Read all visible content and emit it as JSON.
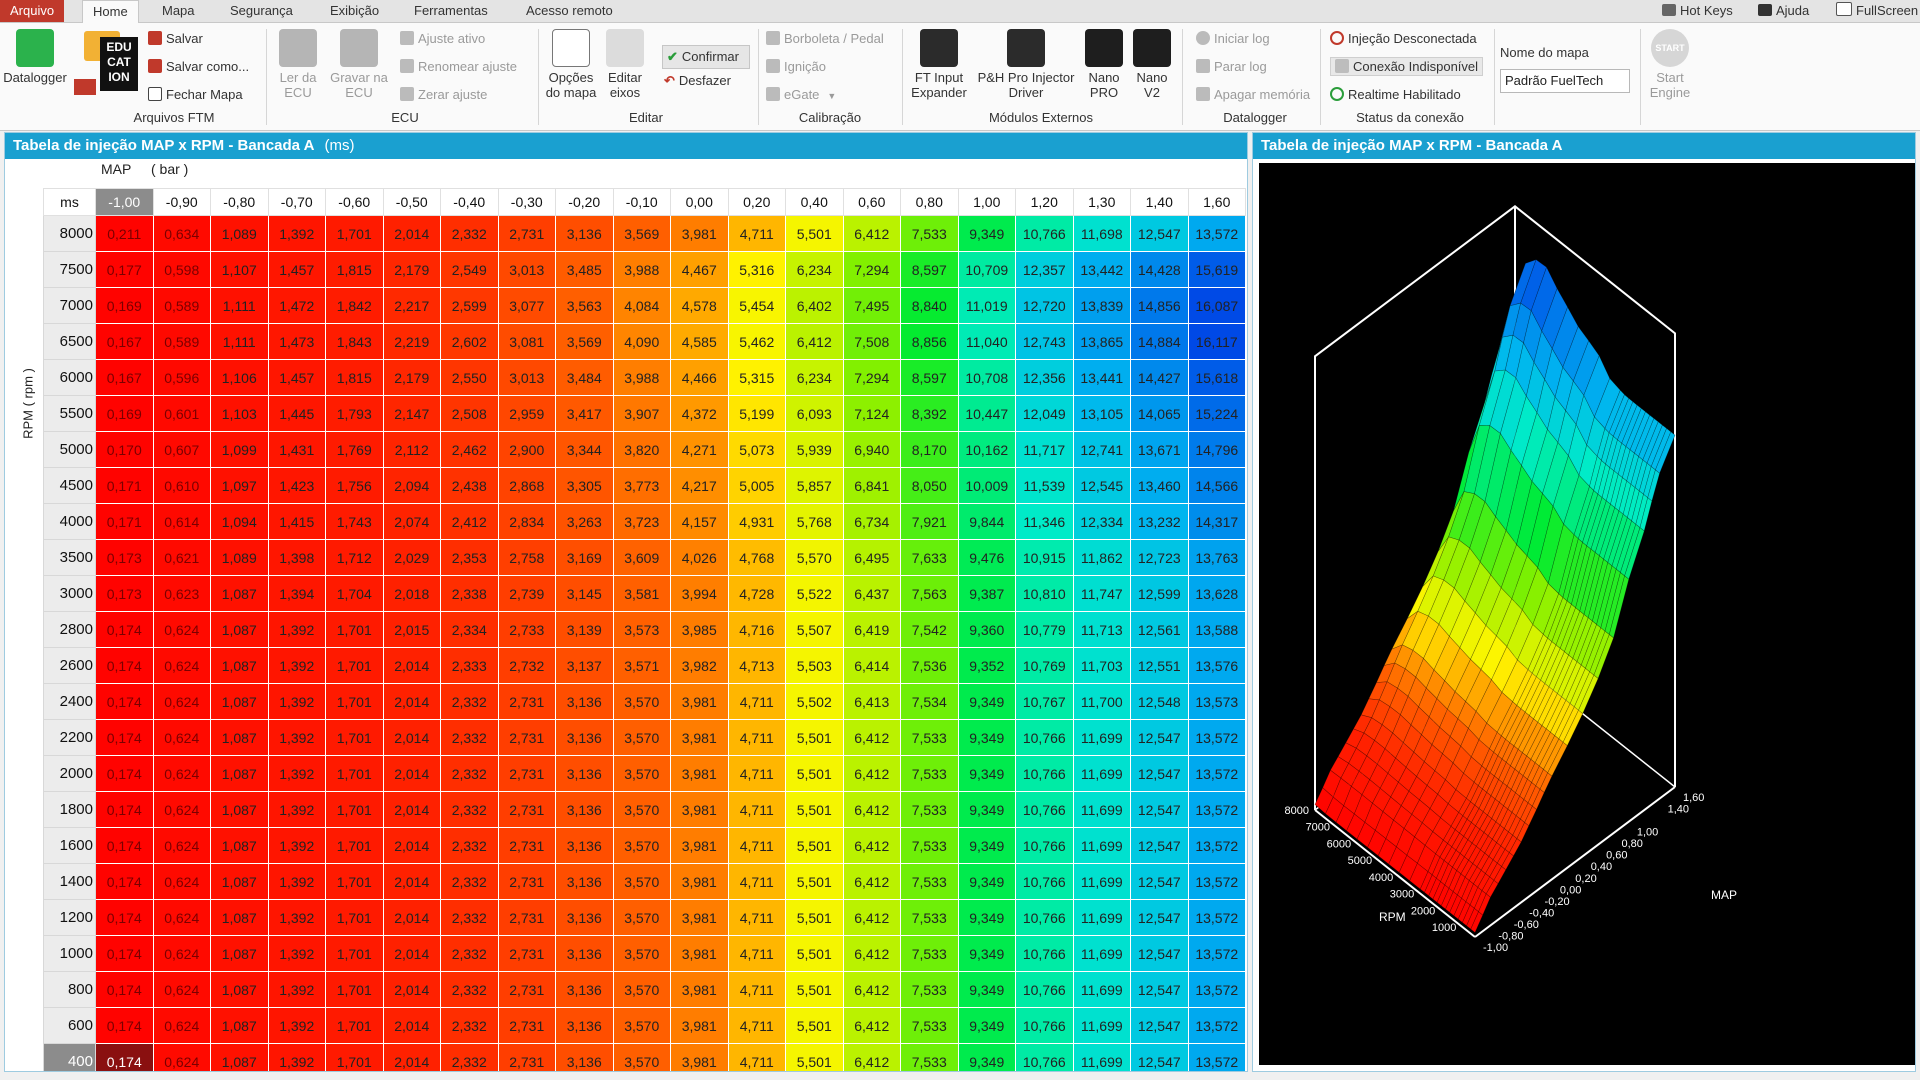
{
  "menubar": {
    "items": [
      "Arquivo",
      "Home",
      "Mapa",
      "Segurança",
      "Exibição",
      "Ferramentas",
      "Acesso remoto"
    ],
    "active": "Home",
    "right": [
      "Hot Keys",
      "Ajuda",
      "FullScreen"
    ]
  },
  "ribbon": {
    "datalogger_app": "Datalogger",
    "arquivos": {
      "salvar": "Salvar",
      "salvar_como": "Salvar como...",
      "fechar": "Fechar Mapa",
      "group": "Arquivos FTM",
      "logo_lines": [
        "EDU",
        "CAT",
        "ION"
      ]
    },
    "ecu": {
      "ler": "Ler da ECU",
      "gravar": "Gravar na ECU",
      "ajuste_ativo": "Ajuste ativo",
      "renomear": "Renomear ajuste",
      "zerar": "Zerar ajuste",
      "group": "ECU"
    },
    "editar": {
      "opcoes": "Opções do mapa",
      "eixos": "Editar eixos",
      "confirmar": "Confirmar",
      "desfazer": "Desfazer",
      "group": "Editar"
    },
    "calibracao": {
      "borboleta": "Borboleta / Pedal",
      "ignicao": "Ignição",
      "egate": "eGate",
      "group": "Calibração"
    },
    "modulos": {
      "ft_input": "FT Input Expander",
      "ph_pro": "P&H Pro Injector Driver",
      "nano_pro": "Nano PRO",
      "nano_v2": "Nano V2",
      "group": "Módulos Externos"
    },
    "datalogger": {
      "iniciar": "Iniciar log",
      "parar": "Parar log",
      "apagar": "Apagar memória",
      "group": "Datalogger"
    },
    "status": {
      "injecao": "Injeção Desconectada",
      "conexao": "Conexão Indisponível",
      "realtime": "Realtime Habilitado",
      "group": "Status da conexão"
    },
    "mapname": {
      "label": "Nome do mapa",
      "value": "Padrão FuelTech"
    },
    "start": {
      "label": "Start Engine",
      "icon_text": "START"
    }
  },
  "table_panel": {
    "title": "Tabela de injeção MAP x RPM - Bancada A",
    "unit": "(ms)",
    "map_label": "MAP",
    "map_unit": "( bar )",
    "corner": "ms",
    "rpm_label": "RPM ( rpm )"
  },
  "plot_panel": {
    "title": "Tabela de injeção MAP x RPM - Bancada A",
    "rpm_axis": "RPM",
    "map_axis": "MAP",
    "rpm_ticks": [
      "8000",
      "7000",
      "6000",
      "5000",
      "4000",
      "3000",
      "2000",
      "1000"
    ],
    "map_ticks": [
      "1,60",
      "1,40",
      "1,00",
      "0,80",
      "0,60",
      "0,40",
      "0,20",
      "0,00",
      "-0,20",
      "-0,40",
      "-0,60",
      "-0,80",
      "-1,00"
    ]
  },
  "colors": {
    "accent": "#1aa0d0",
    "file_menu": "#c0392b"
  },
  "chart_data": {
    "type": "heatmap",
    "title": "Tabela de injeção MAP x RPM - Bancada A",
    "xlabel": "MAP ( bar )",
    "ylabel": "RPM ( rpm )",
    "units": "ms",
    "x": [
      "-1,00",
      "-0,90",
      "-0,80",
      "-0,70",
      "-0,60",
      "-0,50",
      "-0,40",
      "-0,30",
      "-0,20",
      "-0,10",
      "0,00",
      "0,20",
      "0,40",
      "0,60",
      "0,80",
      "1,00",
      "1,20",
      "1,30",
      "1,40",
      "1,60"
    ],
    "y": [
      "8000",
      "7500",
      "7000",
      "6500",
      "6000",
      "5500",
      "5000",
      "4500",
      "4000",
      "3500",
      "3000",
      "2800",
      "2600",
      "2400",
      "2200",
      "2000",
      "1800",
      "1600",
      "1400",
      "1200",
      "1000",
      "800",
      "600",
      "400"
    ],
    "values": [
      [
        "0,211",
        "0,634",
        "1,089",
        "1,392",
        "1,701",
        "2,014",
        "2,332",
        "2,731",
        "3,136",
        "3,569",
        "3,981",
        "4,711",
        "5,501",
        "6,412",
        "7,533",
        "9,349",
        "10,766",
        "11,698",
        "12,547",
        "13,572"
      ],
      [
        "0,177",
        "0,598",
        "1,107",
        "1,457",
        "1,815",
        "2,179",
        "2,549",
        "3,013",
        "3,485",
        "3,988",
        "4,467",
        "5,316",
        "6,234",
        "7,294",
        "8,597",
        "10,709",
        "12,357",
        "13,442",
        "14,428",
        "15,619"
      ],
      [
        "0,169",
        "0,589",
        "1,111",
        "1,472",
        "1,842",
        "2,217",
        "2,599",
        "3,077",
        "3,563",
        "4,084",
        "4,578",
        "5,454",
        "6,402",
        "7,495",
        "8,840",
        "11,019",
        "12,720",
        "13,839",
        "14,856",
        "16,087"
      ],
      [
        "0,167",
        "0,589",
        "1,111",
        "1,473",
        "1,843",
        "2,219",
        "2,602",
        "3,081",
        "3,569",
        "4,090",
        "4,585",
        "5,462",
        "6,412",
        "7,508",
        "8,856",
        "11,040",
        "12,743",
        "13,865",
        "14,884",
        "16,117"
      ],
      [
        "0,167",
        "0,596",
        "1,106",
        "1,457",
        "1,815",
        "2,179",
        "2,550",
        "3,013",
        "3,484",
        "3,988",
        "4,466",
        "5,315",
        "6,234",
        "7,294",
        "8,597",
        "10,708",
        "12,356",
        "13,441",
        "14,427",
        "15,618"
      ],
      [
        "0,169",
        "0,601",
        "1,103",
        "1,445",
        "1,793",
        "2,147",
        "2,508",
        "2,959",
        "3,417",
        "3,907",
        "4,372",
        "5,199",
        "6,093",
        "7,124",
        "8,392",
        "10,447",
        "12,049",
        "13,105",
        "14,065",
        "15,224"
      ],
      [
        "0,170",
        "0,607",
        "1,099",
        "1,431",
        "1,769",
        "2,112",
        "2,462",
        "2,900",
        "3,344",
        "3,820",
        "4,271",
        "5,073",
        "5,939",
        "6,940",
        "8,170",
        "10,162",
        "11,717",
        "12,741",
        "13,671",
        "14,796"
      ],
      [
        "0,171",
        "0,610",
        "1,097",
        "1,423",
        "1,756",
        "2,094",
        "2,438",
        "2,868",
        "3,305",
        "3,773",
        "4,217",
        "5,005",
        "5,857",
        "6,841",
        "8,050",
        "10,009",
        "11,539",
        "12,545",
        "13,460",
        "14,566"
      ],
      [
        "0,171",
        "0,614",
        "1,094",
        "1,415",
        "1,743",
        "2,074",
        "2,412",
        "2,834",
        "3,263",
        "3,723",
        "4,157",
        "4,931",
        "5,768",
        "6,734",
        "7,921",
        "9,844",
        "11,346",
        "12,334",
        "13,232",
        "14,317"
      ],
      [
        "0,173",
        "0,621",
        "1,089",
        "1,398",
        "1,712",
        "2,029",
        "2,353",
        "2,758",
        "3,169",
        "3,609",
        "4,026",
        "4,768",
        "5,570",
        "6,495",
        "7,633",
        "9,476",
        "10,915",
        "11,862",
        "12,723",
        "13,763"
      ],
      [
        "0,173",
        "0,623",
        "1,087",
        "1,394",
        "1,704",
        "2,018",
        "2,338",
        "2,739",
        "3,145",
        "3,581",
        "3,994",
        "4,728",
        "5,522",
        "6,437",
        "7,563",
        "9,387",
        "10,810",
        "11,747",
        "12,599",
        "13,628"
      ],
      [
        "0,174",
        "0,624",
        "1,087",
        "1,392",
        "1,701",
        "2,015",
        "2,334",
        "2,733",
        "3,139",
        "3,573",
        "3,985",
        "4,716",
        "5,507",
        "6,419",
        "7,542",
        "9,360",
        "10,779",
        "11,713",
        "12,561",
        "13,588"
      ],
      [
        "0,174",
        "0,624",
        "1,087",
        "1,392",
        "1,701",
        "2,014",
        "2,333",
        "2,732",
        "3,137",
        "3,571",
        "3,982",
        "4,713",
        "5,503",
        "6,414",
        "7,536",
        "9,352",
        "10,769",
        "11,703",
        "12,551",
        "13,576"
      ],
      [
        "0,174",
        "0,624",
        "1,087",
        "1,392",
        "1,701",
        "2,014",
        "2,332",
        "2,731",
        "3,136",
        "3,570",
        "3,981",
        "4,711",
        "5,502",
        "6,413",
        "7,534",
        "9,349",
        "10,767",
        "11,700",
        "12,548",
        "13,573"
      ],
      [
        "0,174",
        "0,624",
        "1,087",
        "1,392",
        "1,701",
        "2,014",
        "2,332",
        "2,731",
        "3,136",
        "3,570",
        "3,981",
        "4,711",
        "5,501",
        "6,412",
        "7,533",
        "9,349",
        "10,766",
        "11,699",
        "12,547",
        "13,572"
      ],
      [
        "0,174",
        "0,624",
        "1,087",
        "1,392",
        "1,701",
        "2,014",
        "2,332",
        "2,731",
        "3,136",
        "3,570",
        "3,981",
        "4,711",
        "5,501",
        "6,412",
        "7,533",
        "9,349",
        "10,766",
        "11,699",
        "12,547",
        "13,572"
      ],
      [
        "0,174",
        "0,624",
        "1,087",
        "1,392",
        "1,701",
        "2,014",
        "2,332",
        "2,731",
        "3,136",
        "3,570",
        "3,981",
        "4,711",
        "5,501",
        "6,412",
        "7,533",
        "9,349",
        "10,766",
        "11,699",
        "12,547",
        "13,572"
      ],
      [
        "0,174",
        "0,624",
        "1,087",
        "1,392",
        "1,701",
        "2,014",
        "2,332",
        "2,731",
        "3,136",
        "3,570",
        "3,981",
        "4,711",
        "5,501",
        "6,412",
        "7,533",
        "9,349",
        "10,766",
        "11,699",
        "12,547",
        "13,572"
      ],
      [
        "0,174",
        "0,624",
        "1,087",
        "1,392",
        "1,701",
        "2,014",
        "2,332",
        "2,731",
        "3,136",
        "3,570",
        "3,981",
        "4,711",
        "5,501",
        "6,412",
        "7,533",
        "9,349",
        "10,766",
        "11,699",
        "12,547",
        "13,572"
      ],
      [
        "0,174",
        "0,624",
        "1,087",
        "1,392",
        "1,701",
        "2,014",
        "2,332",
        "2,731",
        "3,136",
        "3,570",
        "3,981",
        "4,711",
        "5,501",
        "6,412",
        "7,533",
        "9,349",
        "10,766",
        "11,699",
        "12,547",
        "13,572"
      ],
      [
        "0,174",
        "0,624",
        "1,087",
        "1,392",
        "1,701",
        "2,014",
        "2,332",
        "2,731",
        "3,136",
        "3,570",
        "3,981",
        "4,711",
        "5,501",
        "6,412",
        "7,533",
        "9,349",
        "10,766",
        "11,699",
        "12,547",
        "13,572"
      ],
      [
        "0,174",
        "0,624",
        "1,087",
        "1,392",
        "1,701",
        "2,014",
        "2,332",
        "2,731",
        "3,136",
        "3,570",
        "3,981",
        "4,711",
        "5,501",
        "6,412",
        "7,533",
        "9,349",
        "10,766",
        "11,699",
        "12,547",
        "13,572"
      ],
      [
        "0,174",
        "0,624",
        "1,087",
        "1,392",
        "1,701",
        "2,014",
        "2,332",
        "2,731",
        "3,136",
        "3,570",
        "3,981",
        "4,711",
        "5,501",
        "6,412",
        "7,533",
        "9,349",
        "10,766",
        "11,699",
        "12,547",
        "13,572"
      ],
      [
        "0,174",
        "0,624",
        "1,087",
        "1,392",
        "1,701",
        "2,014",
        "2,332",
        "2,731",
        "3,136",
        "3,570",
        "3,981",
        "4,711",
        "5,501",
        "6,412",
        "7,533",
        "9,349",
        "10,766",
        "11,699",
        "12,547",
        "13,572"
      ]
    ],
    "selected_x": "-1,00",
    "selected_y": "400"
  }
}
